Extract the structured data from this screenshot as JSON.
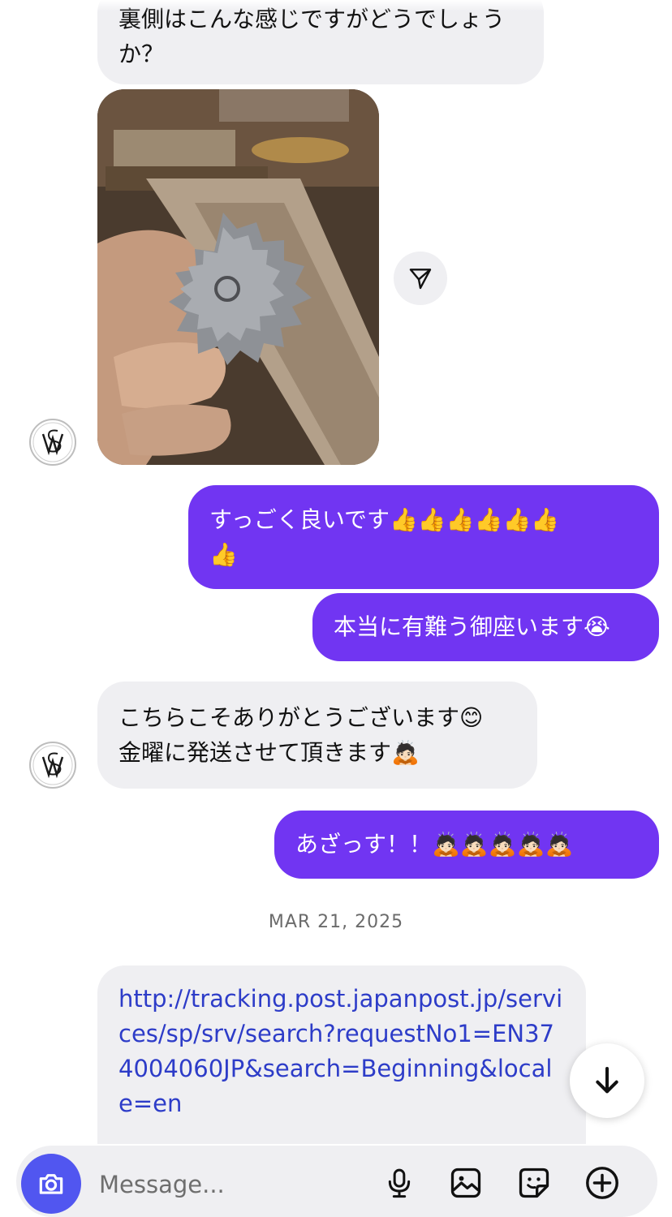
{
  "thread": {
    "messages": [
      {
        "text": "裏側はこんな感じですがどうでしょうか？"
      },
      {
        "text": "すっごく良いです👍👍👍👍👍👍\n👍"
      },
      {
        "text": "本当に有難う御座います😭"
      },
      {
        "text": "こちらこそありがとうございます😊\n金曜に発送させて頂きます🙇🏻"
      },
      {
        "text": "あざっす！！🙇🏻🙇🏻🙇🏻🙇🏻🙇🏻"
      }
    ],
    "date_separator": "MAR 21, 2025",
    "link_text": "http://tracking.post.japanpost.jp/services/sp/srv/search?requestNo1=EN374004060JP&search=Beginning&locale=en"
  },
  "composer": {
    "placeholder": "Message..."
  },
  "icons": {
    "camera": "camera-icon",
    "microphone": "microphone-icon",
    "gallery": "gallery-icon",
    "sticker": "sticker-icon",
    "add": "plus-circle-icon",
    "share": "send-icon",
    "scroll": "arrow-down-icon"
  },
  "colors": {
    "outgoing_bubble": "#7135f2",
    "incoming_bubble": "#efeff2",
    "link": "#2d3cc8",
    "camera_button": "#5156f0"
  }
}
